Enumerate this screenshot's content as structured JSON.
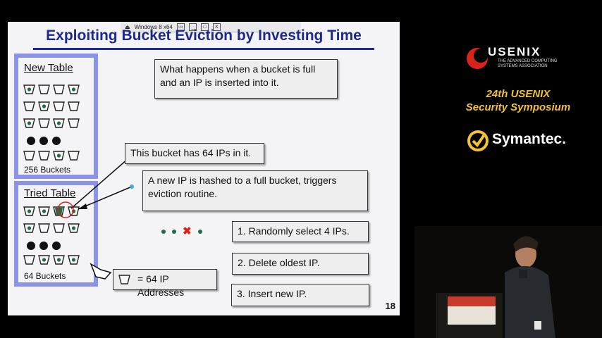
{
  "vm_window": {
    "title": "Windows 8 x64",
    "buttons": [
      "▭",
      "_",
      "□",
      "X"
    ]
  },
  "slide": {
    "title": "Exploiting Bucket Eviction by Investing Time",
    "number": "18",
    "new_table": {
      "title": "New Table",
      "count_label": "256 Buckets"
    },
    "tried_table": {
      "title": "Tried Table",
      "count_label": "64 Buckets"
    },
    "question_box": "What happens when a bucket is full and an IP is inserted into it.",
    "bucket_callout": "This bucket has 64 IPs in it.",
    "new_ip_box": "A new IP is hashed to a full bucket, triggers eviction routine.",
    "steps": [
      "1. Randomly select 4 IPs.",
      "2. Delete oldest IP.",
      "3. Insert new IP."
    ],
    "legend": "= 64 IP Addresses",
    "remove_mark": "✖"
  },
  "branding": {
    "usenix": "USENIX",
    "usenix_sub": "THE ADVANCED COMPUTING SYSTEMS ASSOCIATION",
    "event_line1": "24th USENIX",
    "event_line2": "Security Symposium",
    "sponsor": "Symantec."
  },
  "colors": {
    "title": "#1c2a8c",
    "frame": "#8b93e8",
    "dot": "#1e6b48",
    "gold": "#f2c230",
    "red": "#d9241b"
  }
}
